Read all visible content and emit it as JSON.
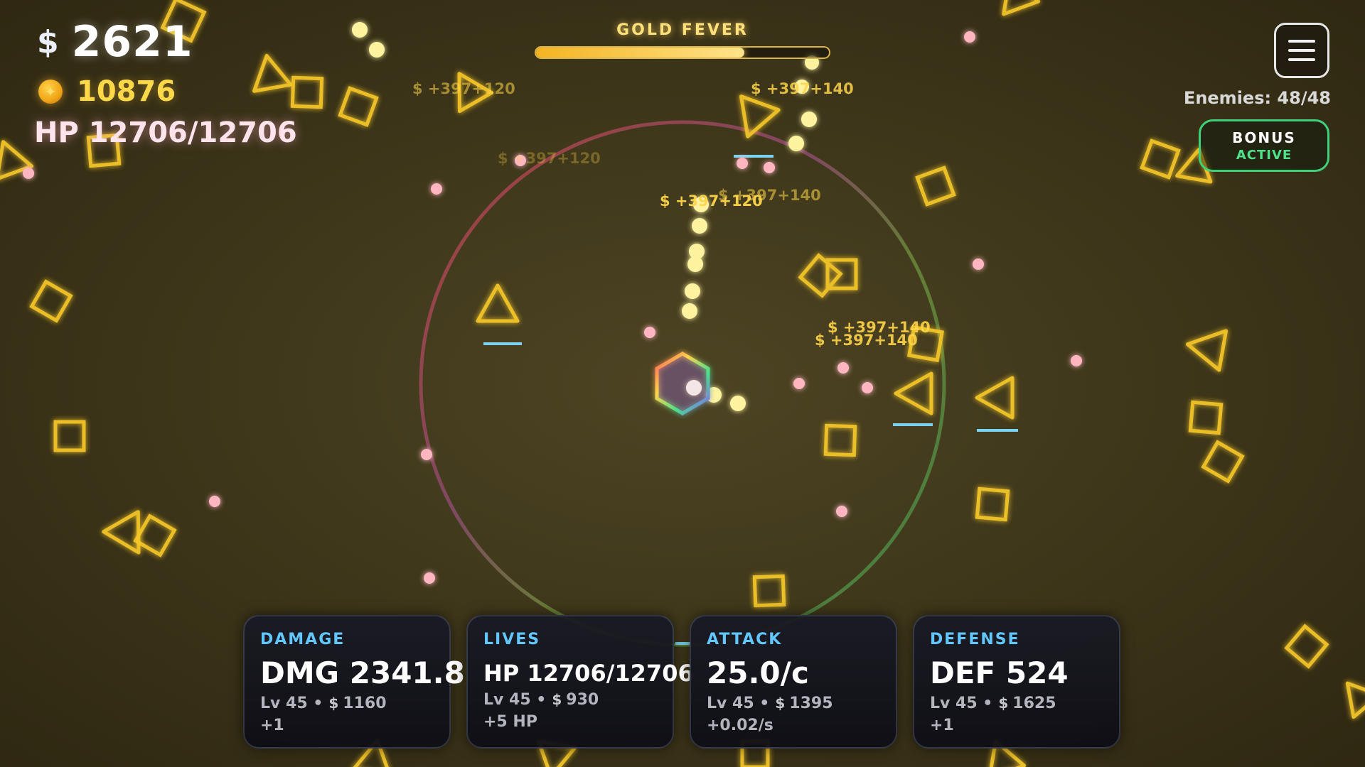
{
  "hud": {
    "money_icon": "$",
    "money": "2621",
    "coin_icon": "coin-icon",
    "coins": "10876",
    "hp": "HP 12706/12706"
  },
  "fever": {
    "label": "GOLD FEVER",
    "progress": 0.71
  },
  "top_right": {
    "menu_icon": "hamburger-menu-icon",
    "enemies": "Enemies: 48/48",
    "bonus_title": "BONUS",
    "bonus_status": "ACTIVE"
  },
  "floating_rewards": [
    {
      "text": "$ +397+120"
    },
    {
      "text": "$ +397+140"
    },
    {
      "text": "$ +397+120"
    },
    {
      "text": "$ +397+140"
    },
    {
      "text": "$ +397+120"
    },
    {
      "text": "$ +397+140"
    },
    {
      "text": "$ +397+140"
    }
  ],
  "stats": [
    {
      "title": "DAMAGE",
      "value": "DMG 2341.8",
      "level": "Lv 45 •",
      "cost": "1160",
      "bonus": "+1"
    },
    {
      "title": "LIVES",
      "value": "HP 12706/12706",
      "level": "Lv 45 •",
      "cost": "930",
      "bonus": "+5 HP"
    },
    {
      "title": "ATTACK",
      "value": "25.0/c",
      "level": "Lv 45 •",
      "cost": "1395",
      "bonus": "+0.02/s"
    },
    {
      "title": "DEFENSE",
      "value": "DEF 524",
      "level": "Lv 45 •",
      "cost": "1625",
      "bonus": "+1"
    }
  ],
  "colors": {
    "enemy": "#f5c72a",
    "bullet": "#fff3a0",
    "enemy_shot": "#ffb6c1",
    "accent_blue": "#62c6ff",
    "bonus_green": "#3fd07a",
    "gold": "#ffd84a"
  }
}
